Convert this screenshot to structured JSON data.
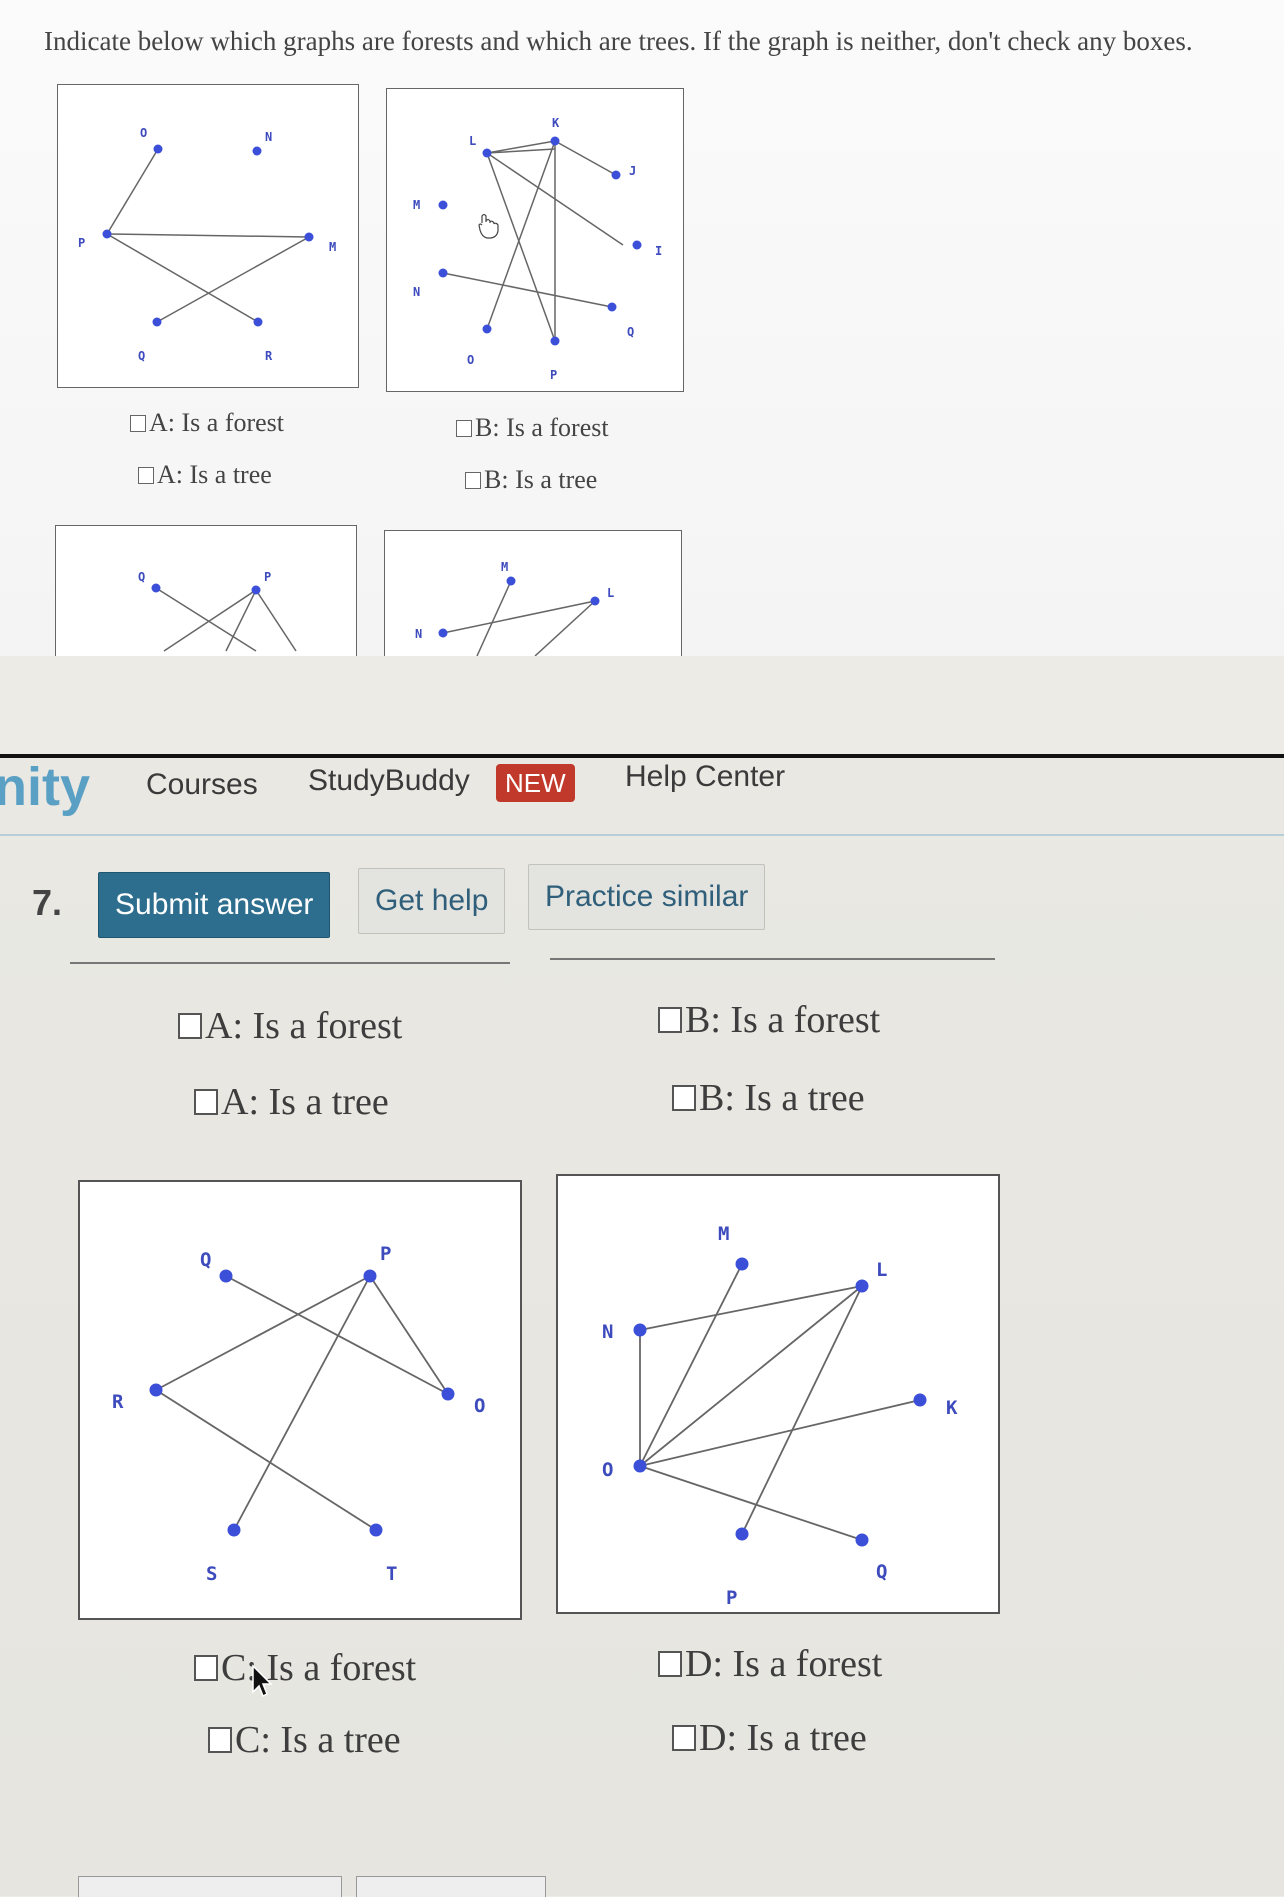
{
  "instructions": "Indicate below which graphs are forests and which are trees. If the graph is neither, don't check any boxes.",
  "top_graphs": {
    "A": {
      "nodes": [
        "O",
        "N",
        "P",
        "M",
        "Q",
        "R"
      ]
    },
    "B": {
      "nodes": [
        "L",
        "K",
        "J",
        "M",
        "I",
        "N",
        "O",
        "P",
        "Q"
      ]
    },
    "C_partial": {
      "nodes": [
        "Q",
        "P"
      ]
    },
    "D_partial": {
      "nodes": [
        "M",
        "N",
        "L"
      ]
    }
  },
  "top_checkboxes": {
    "a_forest": "A: Is a forest",
    "a_tree": "A: Is a tree",
    "b_forest": "B: Is a forest",
    "b_tree": "B: Is a tree"
  },
  "nav": {
    "logo": "nity",
    "courses": "Courses",
    "studybuddy": "StudyBuddy",
    "new_badge": "NEW",
    "help_center": "Help Center"
  },
  "question": {
    "number": "7.",
    "submit": "Submit answer",
    "get_help": "Get help",
    "practice": "Practice similar"
  },
  "checkboxes": {
    "a_forest": "A: Is a forest",
    "a_tree": "A: Is a tree",
    "b_forest": "B: Is a forest",
    "b_tree": "B: Is a tree",
    "c_forest": "C: Is a forest",
    "c_tree": "C: Is a tree",
    "d_forest": "D: Is a forest",
    "d_tree": "D: Is a tree"
  },
  "graph_c": {
    "nodes": [
      "Q",
      "P",
      "R",
      "O",
      "S",
      "T"
    ]
  },
  "graph_d": {
    "nodes": [
      "M",
      "L",
      "N",
      "K",
      "O",
      "Q",
      "P"
    ]
  },
  "colors": {
    "node": "#3b4fd8",
    "label": "#3d4bbd",
    "edge": "#666666",
    "nav_accent": "#5aa0c4",
    "primary_button": "#2d6e8e",
    "badge": "#c0392b"
  }
}
